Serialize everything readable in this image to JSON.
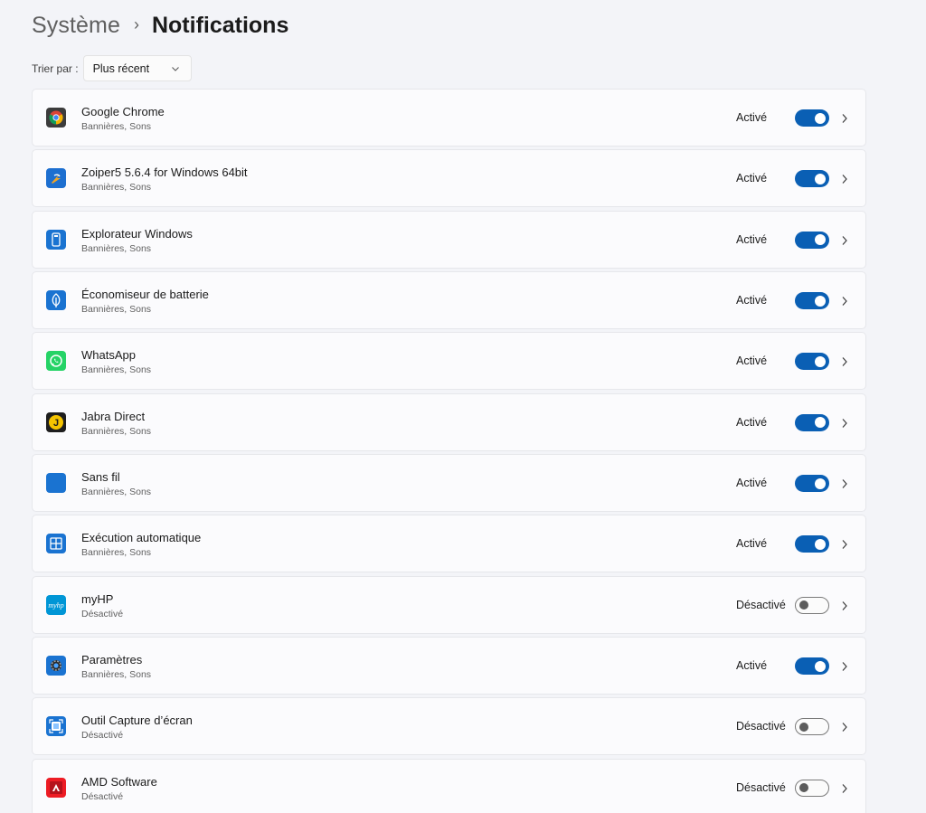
{
  "breadcrumb": {
    "parent": "Système",
    "separator": "›",
    "current": "Notifications"
  },
  "sort": {
    "label": "Trier par :",
    "value": "Plus récent"
  },
  "apps": [
    {
      "name": "Google Chrome",
      "subtitle": "Bannières, Sons",
      "state_label": "Activé",
      "enabled": true,
      "icon": "chrome-icon"
    },
    {
      "name": "Zoiper5 5.6.4 for Windows 64bit",
      "subtitle": "Bannières, Sons",
      "state_label": "Activé",
      "enabled": true,
      "icon": "zoiper-icon"
    },
    {
      "name": "Explorateur Windows",
      "subtitle": "Bannières, Sons",
      "state_label": "Activé",
      "enabled": true,
      "icon": "explorer-icon"
    },
    {
      "name": "Économiseur de batterie",
      "subtitle": "Bannières, Sons",
      "state_label": "Activé",
      "enabled": true,
      "icon": "battery-saver-icon"
    },
    {
      "name": "WhatsApp",
      "subtitle": "Bannières, Sons",
      "state_label": "Activé",
      "enabled": true,
      "icon": "whatsapp-icon"
    },
    {
      "name": "Jabra Direct",
      "subtitle": "Bannières, Sons",
      "state_label": "Activé",
      "enabled": true,
      "icon": "jabra-icon"
    },
    {
      "name": "Sans fil",
      "subtitle": "Bannières, Sons",
      "state_label": "Activé",
      "enabled": true,
      "icon": "wireless-icon"
    },
    {
      "name": "Exécution automatique",
      "subtitle": "Bannières, Sons",
      "state_label": "Activé",
      "enabled": true,
      "icon": "autoplay-icon"
    },
    {
      "name": "myHP",
      "subtitle": "Désactivé",
      "state_label": "Désactivé",
      "enabled": false,
      "icon": "myhp-icon",
      "icon_text": "myhp"
    },
    {
      "name": "Paramètres",
      "subtitle": "Bannières, Sons",
      "state_label": "Activé",
      "enabled": true,
      "icon": "settings-gear-icon"
    },
    {
      "name": "Outil Capture d’écran",
      "subtitle": "Désactivé",
      "state_label": "Désactivé",
      "enabled": false,
      "icon": "snipping-tool-icon"
    },
    {
      "name": "AMD Software",
      "subtitle": "Désactivé",
      "state_label": "Désactivé",
      "enabled": false,
      "icon": "amd-icon"
    }
  ],
  "colors": {
    "accent": "#0a5fb4",
    "page_background": "#f3f4f8",
    "card_background": "#fbfbfd"
  }
}
